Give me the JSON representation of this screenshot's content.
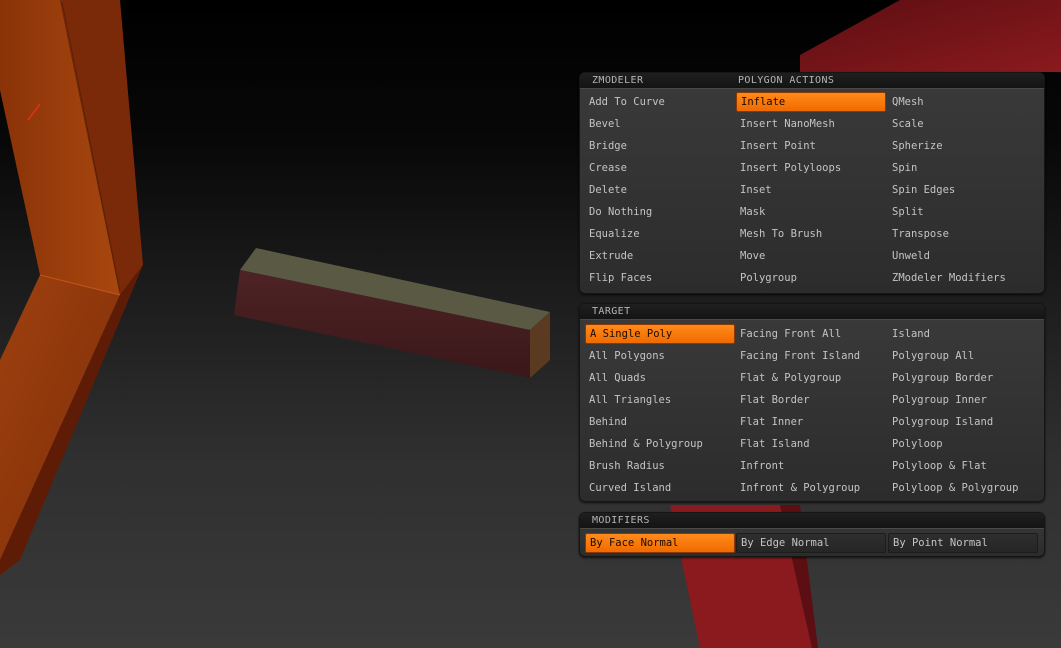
{
  "zmodeler_panel": {
    "header_left": "ZMODELER",
    "header_right": "POLYGON ACTIONS",
    "columns": [
      [
        "Add To Curve",
        "Bevel",
        "Bridge",
        "Crease",
        "Delete",
        "Do Nothing",
        "Equalize",
        "Extrude",
        "Flip Faces"
      ],
      [
        "Inflate",
        "Insert NanoMesh",
        "Insert Point",
        "Insert Polyloops",
        "Inset",
        "Mask",
        "Mesh To Brush",
        "Move",
        "Polygroup"
      ],
      [
        "QMesh",
        "Scale",
        "Spherize",
        "Spin",
        "Spin Edges",
        "Split",
        "Transpose",
        "Unweld",
        "ZModeler Modifiers"
      ]
    ],
    "selected": "Inflate"
  },
  "target_panel": {
    "header": "TARGET",
    "columns": [
      [
        "A Single Poly",
        "All Polygons",
        "All Quads",
        "All Triangles",
        "Behind",
        "Behind & Polygroup",
        "Brush Radius",
        "Curved Island"
      ],
      [
        "Facing Front All",
        "Facing Front Island",
        "Flat & Polygroup",
        "Flat Border",
        "Flat Inner",
        "Flat Island",
        "Infront",
        "Infront & Polygroup"
      ],
      [
        "Island",
        "Polygroup All",
        "Polygroup Border",
        "Polygroup Inner",
        "Polygroup Island",
        "Polyloop",
        "Polyloop & Flat",
        "Polyloop & Polygroup"
      ]
    ],
    "selected": "A Single Poly"
  },
  "modifiers_panel": {
    "header": "MODIFIERS",
    "options": [
      "By Face Normal",
      "By Edge Normal",
      "By Point Normal"
    ],
    "selected": "By Face Normal"
  },
  "colors": {
    "accent": "#f07a10",
    "mesh_orange": "#a2400f",
    "mesh_red": "#7e1418",
    "box_top": "#5a5a44",
    "box_side": "#4a1f22"
  }
}
